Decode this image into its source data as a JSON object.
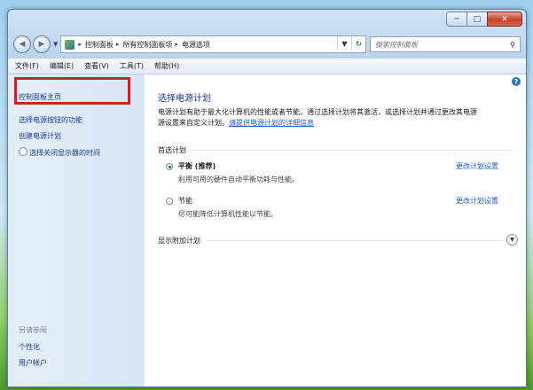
{
  "window": {
    "min_glyph": "─",
    "max_glyph": "□",
    "close_glyph": "✕"
  },
  "address": {
    "crumbs": [
      "控制面板",
      "所有控制面板项",
      "电源选项"
    ],
    "search_placeholder": "搜索控制面板"
  },
  "menubar": [
    "文件(F)",
    "编辑(E)",
    "查看(V)",
    "工具(T)",
    "帮助(H)"
  ],
  "sidebar": {
    "home": "控制面板主页",
    "links": [
      "选择电源按钮的功能",
      "创建电源计划",
      "选择关闭显示器的时间"
    ],
    "see_also": "另请参阅",
    "see_also_links": [
      "个性化",
      "用户帐户"
    ]
  },
  "main": {
    "title": "选择电源计划",
    "desc_line1": "电源计划有助于最大化计算机的性能或者节能。通过选择计划将其激活，或选择计划并通过更改其电源",
    "desc_line2": "源设置来自定义计划。",
    "desc_link": "请提供电源计划的详细信息",
    "preferred_heading": "首选计划",
    "plans": [
      {
        "name": "平衡 (推荐)",
        "desc": "利用可用的硬件自动平衡功耗与性能。",
        "link": "更改计划设置",
        "selected": true
      },
      {
        "name": "节能",
        "desc": "尽可能降低计算机性能以节能。",
        "link": "更改计划设置",
        "selected": false
      }
    ],
    "extra_heading": "显示附加计划"
  }
}
